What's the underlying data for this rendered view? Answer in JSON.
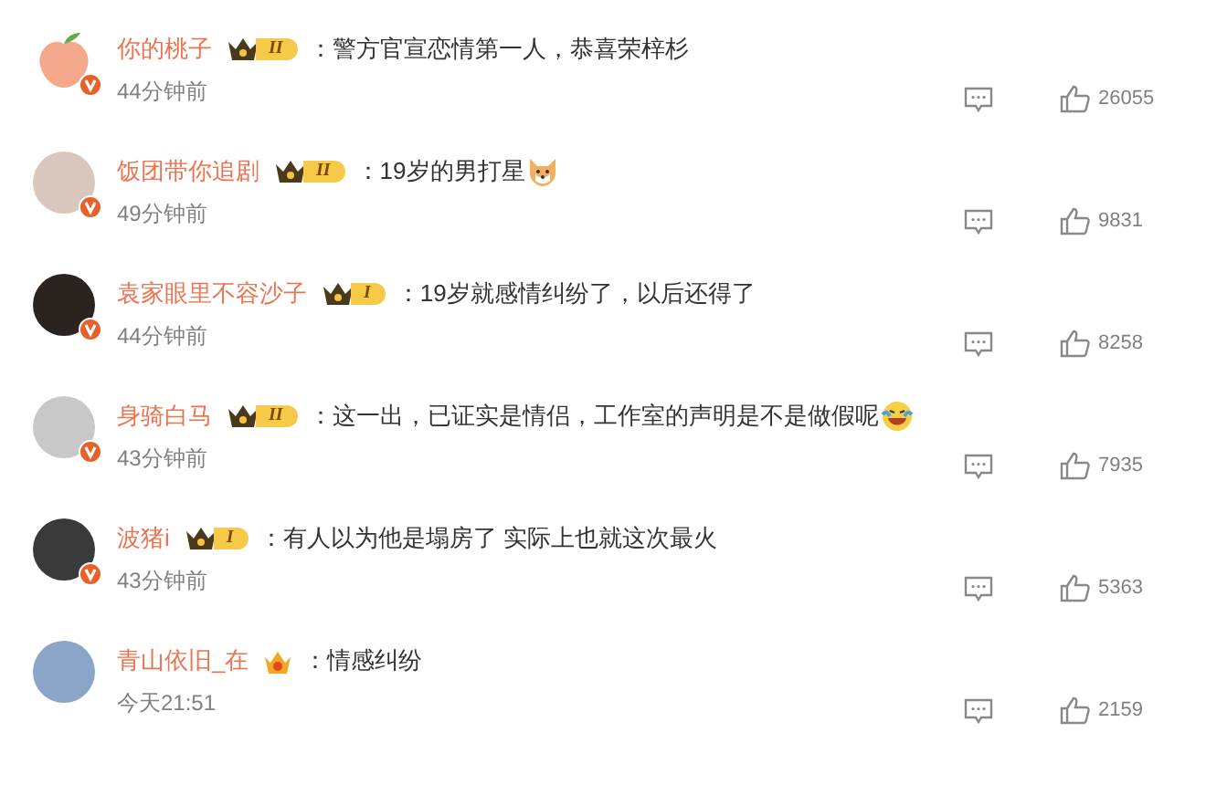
{
  "comments": [
    {
      "user": "你的桃子",
      "verified": true,
      "avatar": {
        "kind": "peach"
      },
      "badge": {
        "kind": "crown_level",
        "text": "II"
      },
      "text": "：警方官宣恋情第一人，恭喜荣梓杉",
      "time": "44分钟前",
      "likes": "26055"
    },
    {
      "user": "饭团带你追剧",
      "verified": true,
      "avatar": {
        "kind": "photo"
      },
      "badge": {
        "kind": "crown_level",
        "text": "II"
      },
      "text": "：19岁的男打星",
      "emoji": {
        "kind": "dog"
      },
      "time": "49分钟前",
      "likes": "9831"
    },
    {
      "user": "袁家眼里不容沙子",
      "verified": true,
      "avatar": {
        "kind": "photo"
      },
      "badge": {
        "kind": "crown_level",
        "text": "I"
      },
      "text": "：19岁就感情纠纷了，以后还得了",
      "time": "44分钟前",
      "likes": "8258"
    },
    {
      "user": "身骑白马",
      "verified": true,
      "avatar": {
        "kind": "photo"
      },
      "badge": {
        "kind": "crown_level",
        "text": "II"
      },
      "text": "：这一出，已证实是情侣，工作室的声明是不是做假呢",
      "emoji": {
        "kind": "laugh"
      },
      "time": "43分钟前",
      "likes": "7935"
    },
    {
      "user": "波猪i",
      "verified": true,
      "avatar": {
        "kind": "photo"
      },
      "badge": {
        "kind": "crown_level",
        "text": "I"
      },
      "text": "：有人以为他是塌房了 实际上也就这次最火",
      "time": "43分钟前",
      "likes": "5363"
    },
    {
      "user": "青山依旧_在",
      "verified": false,
      "avatar": {
        "kind": "photo"
      },
      "badge": {
        "kind": "member"
      },
      "text": "：情感纠纷",
      "time": "今天21:51",
      "likes": "2159"
    }
  ]
}
